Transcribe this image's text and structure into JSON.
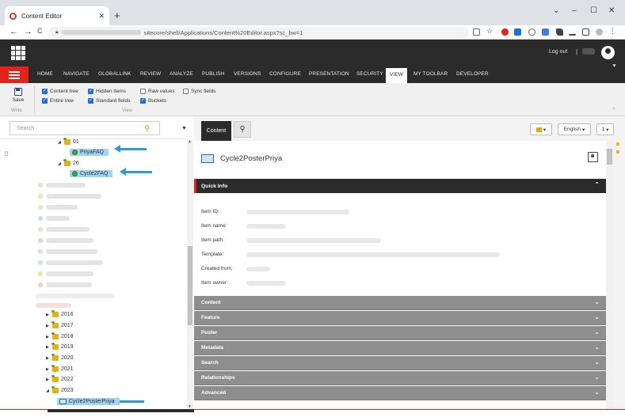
{
  "browser": {
    "tab_title": "Content Editor",
    "tab_close": "✕",
    "new_tab": "+",
    "url_path": "sitecore/shell/Applications/Content%20Editor.aspx?sc_bw=1",
    "back": "←",
    "forward": "→",
    "reload": "C",
    "minimize": "–",
    "restore": "☐",
    "close": "✕",
    "tab_list": "⌄"
  },
  "topbar": {
    "logout_label": "Log out",
    "separator": "|"
  },
  "ribbon_tabs": [
    "HOME",
    "NAVIGATE",
    "GLOBALLINK",
    "REVIEW",
    "ANALYZE",
    "PUBLISH",
    "VERSIONS",
    "CONFIGURE",
    "PRESENTATION",
    "SECURITY",
    "VIEW",
    "MY TOOLBAR",
    "DEVELOPER"
  ],
  "ribbon": {
    "save_label": "Save",
    "write_group": "Write",
    "view_group": "View",
    "checkboxes": [
      {
        "label": "Content tree",
        "checked": true
      },
      {
        "label": "Entire tree",
        "checked": true
      },
      {
        "label": "Hidden items",
        "checked": true
      },
      {
        "label": "Standard fields",
        "checked": true
      },
      {
        "label": "Raw values",
        "checked": false
      },
      {
        "label": "Buckets",
        "checked": true
      },
      {
        "label": "Sync fields",
        "checked": false
      }
    ]
  },
  "tree": {
    "search_placeholder": "Search",
    "folder_01": "01",
    "item_priya_faq": "PriyaFAQ",
    "folder_26": "26",
    "item_cycle2_faq": "Cycle2FAQ",
    "years": [
      "2016",
      "2017",
      "2018",
      "2019",
      "2020",
      "2021",
      "2022",
      "2023"
    ],
    "item_cycle2_poster": "Cycle2PosterPriya"
  },
  "content": {
    "tab_label": "Content",
    "language": "English",
    "version": "1",
    "item_title": "Cycle2PosterPriya",
    "quick_info_label": "Quick Info",
    "fields": [
      "Item ID:",
      "Item name:",
      "Item path:",
      "Template:",
      "Created from:",
      "Item owner:"
    ],
    "sections": [
      "Content",
      "Feature",
      "Poster",
      "Metadata",
      "Search",
      "Relationships",
      "Advanced"
    ]
  },
  "colors": {
    "accent_red": "#e2231a",
    "dark_bar": "#2b2b2b",
    "selected_node": "#9fd4f5",
    "annotation_arrow": "#2a9ad8"
  }
}
